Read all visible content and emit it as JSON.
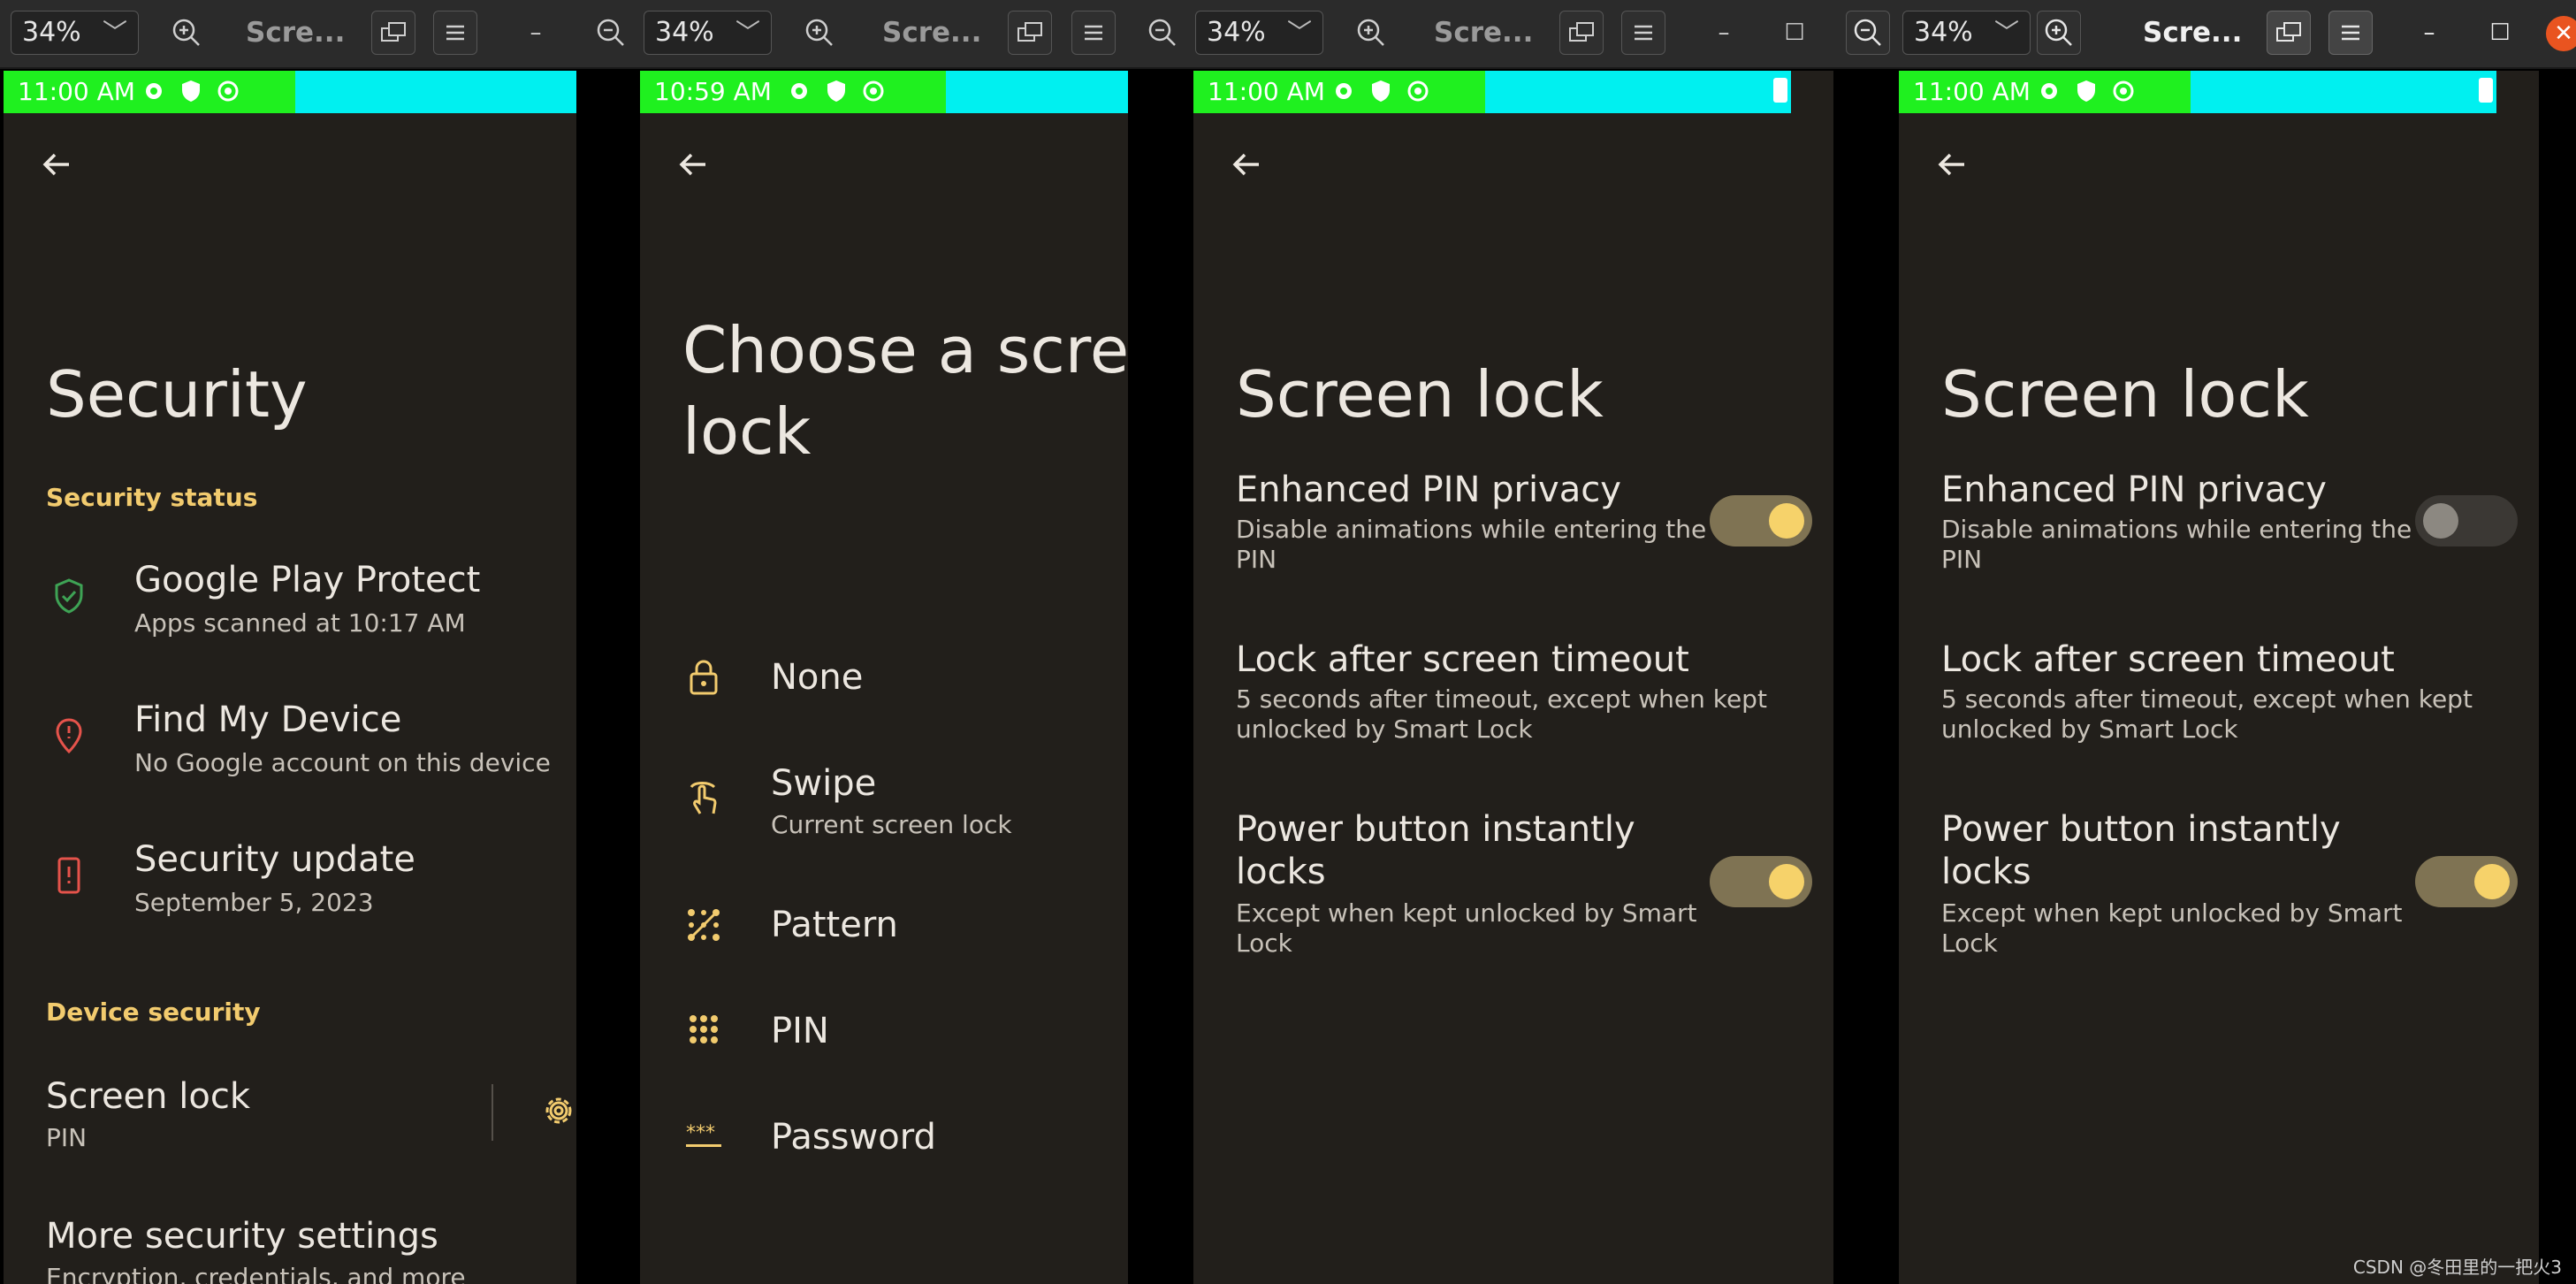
{
  "windows": [
    {
      "zoom": "34%",
      "title": "Scre..."
    },
    {
      "zoom": "34%",
      "title": "Scre..."
    },
    {
      "zoom": "34%",
      "title": "Scre..."
    },
    {
      "zoom": "34%",
      "title": "Scre..."
    }
  ],
  "screens": {
    "security": {
      "time": "11:00 AM",
      "title": "Security",
      "section_status": "Security status",
      "items": [
        {
          "title": "Google Play Protect",
          "subtitle": "Apps scanned at 10:17 AM"
        },
        {
          "title": "Find My Device",
          "subtitle": "No Google account on this device"
        },
        {
          "title": "Security update",
          "subtitle": "September 5, 2023"
        }
      ],
      "section_device": "Device security",
      "screen_lock": {
        "title": "Screen lock",
        "subtitle": "PIN"
      },
      "more": {
        "title": "More security settings",
        "subtitle": "Encryption, credentials, and more"
      }
    },
    "choose": {
      "time": "10:59 AM",
      "title_line1": "Choose a scree",
      "title_line2": "lock",
      "options": [
        {
          "label": "None",
          "subtitle": ""
        },
        {
          "label": "Swipe",
          "subtitle": "Current screen lock"
        },
        {
          "label": "Pattern",
          "subtitle": ""
        },
        {
          "label": "PIN",
          "subtitle": ""
        },
        {
          "label": "Password",
          "subtitle": ""
        }
      ]
    },
    "screenlock_a": {
      "time": "11:00 AM",
      "title": "Screen lock",
      "settings": [
        {
          "title": "Enhanced PIN privacy",
          "subtitle_1": "Disable animations while entering the",
          "subtitle_2": "PIN",
          "toggle": true
        },
        {
          "title": "Lock after screen timeout",
          "subtitle_1": "5 seconds after timeout, except when kept",
          "subtitle_2": "unlocked by Smart Lock",
          "toggle": null
        },
        {
          "title_1": "Power button instantly",
          "title_2": "locks",
          "subtitle_1": "Except when kept unlocked by Smart",
          "subtitle_2": "Lock",
          "toggle": true
        }
      ]
    },
    "screenlock_b": {
      "time": "11:00 AM",
      "title": "Screen lock",
      "settings": [
        {
          "title": "Enhanced PIN privacy",
          "subtitle_1": "Disable animations while entering the",
          "subtitle_2": "PIN",
          "toggle": false
        },
        {
          "title": "Lock after screen timeout",
          "subtitle_1": "5 seconds after timeout, except when kept",
          "subtitle_2": "unlocked by Smart Lock",
          "toggle": null
        },
        {
          "title_1": "Power button instantly",
          "title_2": "locks",
          "subtitle_1": "Except when kept unlocked by Smart",
          "subtitle_2": "Lock",
          "toggle": true
        }
      ]
    }
  },
  "colors": {
    "accent": "#f2cb6e",
    "background": "#221f1b",
    "status_green": "#1ff01f",
    "status_cyan": "#00f0f0",
    "toggle_on_track": "#7f7353",
    "toggle_on_knob": "#f6d26a"
  },
  "watermark": "CSDN @冬田里的一把火3"
}
